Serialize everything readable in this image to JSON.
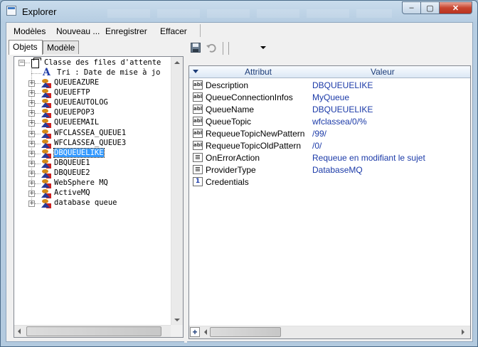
{
  "window": {
    "title": "Explorer",
    "controls": {
      "minimize": "–",
      "maximize": "▢",
      "close": "✕"
    }
  },
  "menu": {
    "items": [
      "Modèles",
      "Nouveau ...",
      "Enregistrer",
      "Effacer"
    ]
  },
  "tabs": {
    "items": [
      "Objets",
      "Modèle"
    ],
    "active": "Objets"
  },
  "tree": {
    "root": "Classe des files d'attente",
    "sort_node": "Tri   : Date de mise à jo",
    "queues": [
      "QUEUEAZURE",
      "QUEUEFTP",
      "QUEUEAUTOLOG",
      "QUEUEPOP3",
      "QUEUEEMAIL",
      "WFCLASSEA_QUEUE1",
      "WFCLASSEA_QUEUE3",
      "DBQUEUELIKE",
      "DBQUEUE1",
      "DBQUEUE2",
      "WebSphere MQ",
      "ActiveMQ",
      "database queue"
    ],
    "selected": "DBQUEUELIKE"
  },
  "toolbar": {
    "icons": [
      "save-icon",
      "undo-icon",
      "dropdown-arrow-icon"
    ]
  },
  "grid": {
    "columns": {
      "attribute": "Attribut",
      "value": "Valeur"
    },
    "rows": [
      {
        "name": "Description",
        "value": "DBQUEUELIKE",
        "icon": "abl"
      },
      {
        "name": "QueueConnectionInfos",
        "value": "MyQueue",
        "icon": "abl"
      },
      {
        "name": "QueueName",
        "value": "DBQUEUELIKE",
        "icon": "abl"
      },
      {
        "name": "QueueTopic",
        "value": "wfclassea/0/%",
        "icon": "abl"
      },
      {
        "name": "RequeueTopicNewPattern",
        "value": "/99/",
        "icon": "abl"
      },
      {
        "name": "RequeueTopicOldPattern",
        "value": "/0/",
        "icon": "abl"
      },
      {
        "name": "OnErrorAction",
        "value": "Requeue en modifiant le sujet",
        "icon": "list"
      },
      {
        "name": "ProviderType",
        "value": "DatabaseMQ",
        "icon": "list"
      },
      {
        "name": "Credentials",
        "value": "",
        "icon": "num"
      }
    ],
    "icon_text": {
      "abl": "abl",
      "list": "≡",
      "num": "1"
    },
    "add_button": "+"
  },
  "colors": {
    "selection": "#3399ff",
    "value_text": "#1b3aa8",
    "header_text": "#1c3c78"
  }
}
